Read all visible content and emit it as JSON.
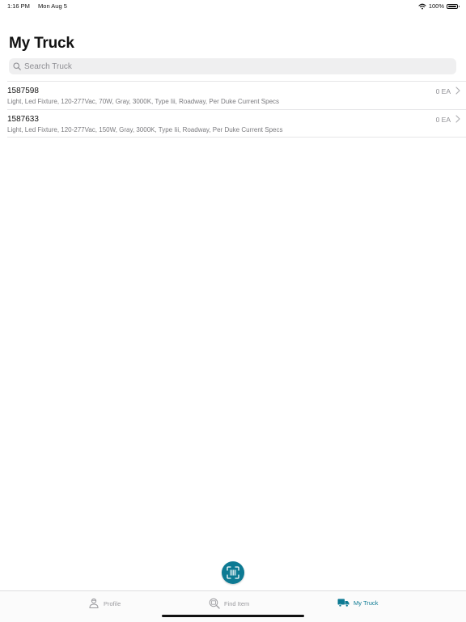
{
  "status_bar": {
    "time": "1:16 PM",
    "date": "Mon Aug 5",
    "battery": "100%",
    "battery_level": 1.0
  },
  "page": {
    "title": "My Truck"
  },
  "search": {
    "placeholder": "Search Truck",
    "icon": "search-icon"
  },
  "items": [
    {
      "id": "1587598",
      "description": "Light, Led Fixture, 120-277Vac, 70W, Gray, 3000K, Type Iii, Roadway, Per Duke Current Specs",
      "quantity": "0 EA"
    },
    {
      "id": "1587633",
      "description": "Light, Led Fixture, 120-277Vac, 150W, Gray, 3000K, Type Iii, Roadway, Per Duke Current Specs",
      "quantity": "0 EA"
    }
  ],
  "scan_button": {
    "icon": "barcode-scan-icon"
  },
  "tab_bar": {
    "tabs": [
      {
        "label": "Profile",
        "icon": "profile-icon",
        "active": false
      },
      {
        "label": "Find Item",
        "icon": "find-item-icon",
        "active": false
      },
      {
        "label": "My Truck",
        "icon": "truck-icon",
        "active": true
      }
    ]
  },
  "colors": {
    "accent": "#0d7a93",
    "inactive": "#9a9a9e",
    "search_bg": "#efeff0"
  }
}
